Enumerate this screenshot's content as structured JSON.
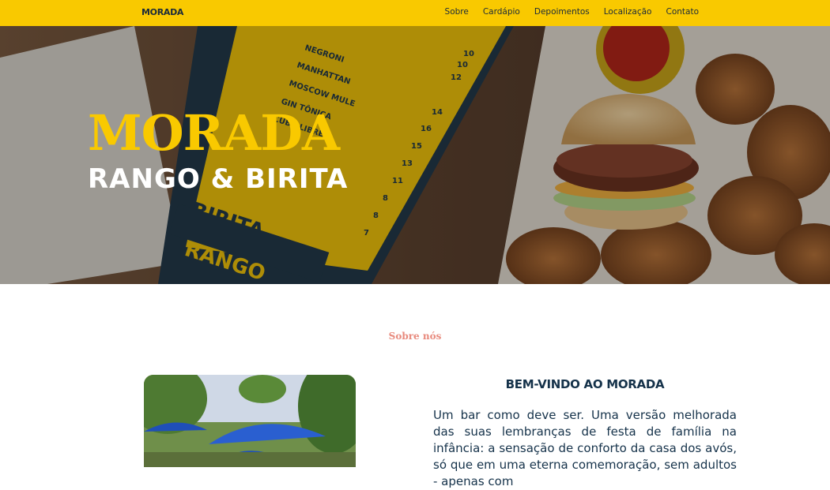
{
  "nav": {
    "logo": "MORADA",
    "links": [
      "Sobre",
      "Cardápio",
      "Depoimentos",
      "Localização",
      "Contato"
    ]
  },
  "hero": {
    "title": "MORADA",
    "subtitle": "RANGO & BIRITA",
    "menu_items": [
      "NEGRONI",
      "MANHATTAN",
      "MOSCOW MULE",
      "GIN TÔNICA",
      "CUBA LIBRE"
    ],
    "menu_prices": [
      "10",
      "10",
      "12",
      "14",
      "16",
      "15",
      "13",
      "11",
      "8",
      "8",
      "7"
    ],
    "board_labels": [
      "BIRITA",
      "RANGO"
    ]
  },
  "about": {
    "section_label": "Sobre nós",
    "heading": "BEM-VINDO AO MORADA",
    "text": "Um bar como deve ser. Uma versão melhorada das suas lembranças de festa de família na infância: a sensação de conforto da casa dos avós, só que em uma eterna comemoração, sem adultos - apenas com"
  },
  "colors": {
    "accent_yellow": "#f9c900",
    "navy": "#15324a",
    "salmon": "#e88a7d"
  }
}
